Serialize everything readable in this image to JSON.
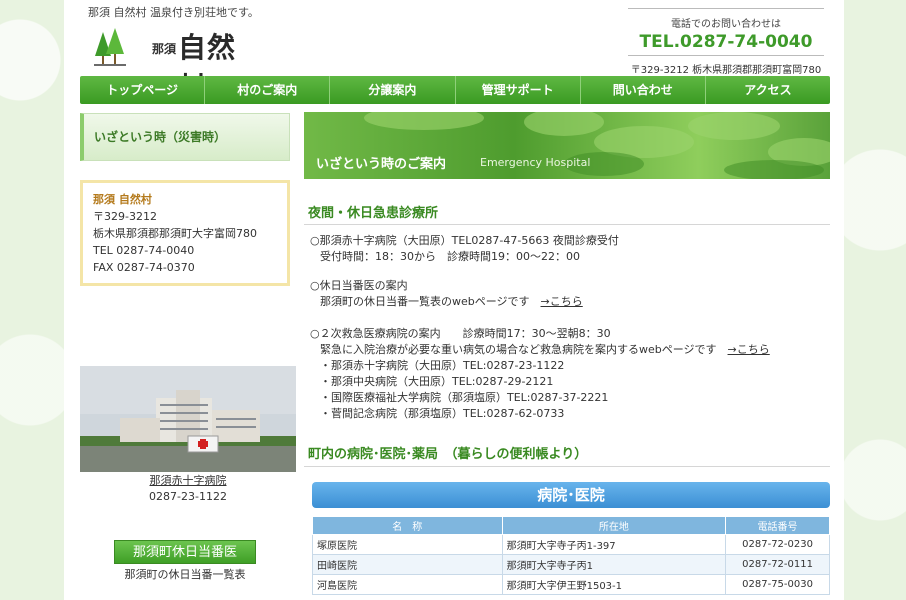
{
  "header": {
    "tagline": "那須 自然村 温泉付き別荘地です。",
    "logo_small": "那須",
    "logo_big": "自然村",
    "contact_label": "電話でのお問い合わせは",
    "tel": "TEL.0287-74-0040",
    "address": "〒329-3212 栃木県那須郡那須町富岡780"
  },
  "nav": [
    "トップページ",
    "村のご案内",
    "分譲案内",
    "管理サポート",
    "問い合わせ",
    "アクセス"
  ],
  "sidebar": {
    "title": "いざという時（災害時）",
    "addr_name": "那須 自然村",
    "addr_lines": [
      "〒329-3212",
      "栃木県那須郡那須町大字富岡780",
      "TEL 0287-74-0040",
      "FAX 0287-74-0370"
    ],
    "photo_caption": "那須赤十字病院",
    "photo_tel": "0287-23-1122",
    "banner": "那須町休日当番医",
    "banner_caption": "那須町の休日当番一覧表"
  },
  "hero": {
    "title": "いざという時のご案内",
    "subtitle": "Emergency Hospital"
  },
  "section1": {
    "heading": "夜間・休日急患診療所",
    "b1_l1": "○那須赤十字病院（大田原）TEL0287-47-5663 夜間診療受付",
    "b1_l2": "受付時間：18：30から　診療時間19：00～22：00",
    "b2_l1": "○休日当番医の案内",
    "b2_l2": "那須町の休日当番一覧表のwebページです　",
    "b2_link": "→こちら",
    "b3_l1": "○２次救急医療病院の案内　　診療時間17：30～翌朝8：30",
    "b3_l2": "緊急に入院治療が必要な重い病気の場合など救急病院を案内するwebページです　",
    "b3_link": "→こちら",
    "hospitals": [
      "・那須赤十字病院（大田原）TEL:0287-23-1122",
      "・那須中央病院（大田原）TEL:0287-29-2121",
      "・国際医療福祉大学病院（那須塩原）TEL:0287-37-2221",
      "・菅間記念病院（那須塩原）TEL:0287-62-0733"
    ]
  },
  "section2": {
    "heading": "町内の病院･医院･薬局　（暮らしの便利帳より）",
    "table_banner": "病院･医院",
    "columns": [
      "名　称",
      "所在地",
      "電話番号"
    ],
    "rows": [
      [
        "塚原医院",
        "那須町大字寺子丙1-397",
        "0287-72-0230"
      ],
      [
        "田崎医院",
        "那須町大字寺子丙1",
        "0287-72-0111"
      ],
      [
        "河島医院",
        "那須町大字伊王野1503-1",
        "0287-75-0030"
      ]
    ]
  }
}
